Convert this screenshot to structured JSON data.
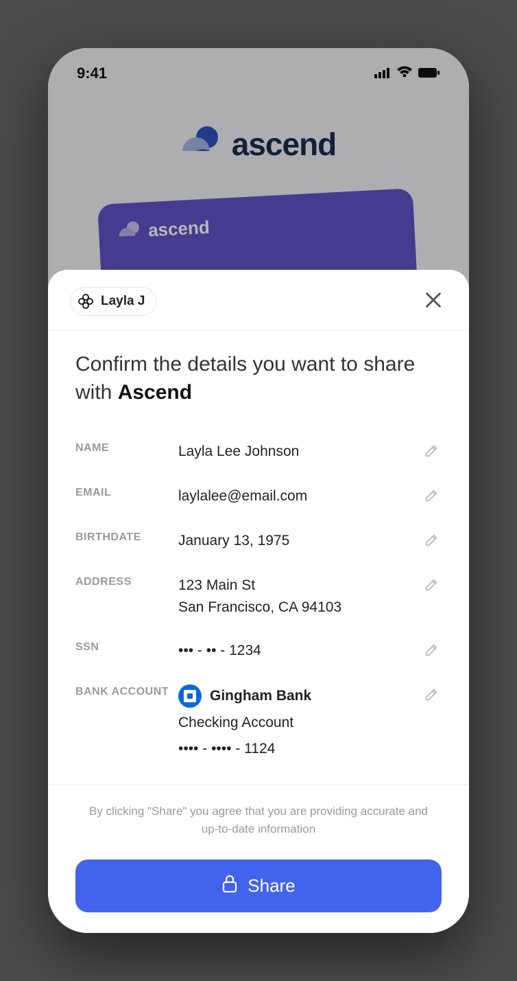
{
  "status": {
    "time": "9:41"
  },
  "brand": {
    "name": "ascend",
    "card_text": "ascend"
  },
  "sheet": {
    "chip_label": "Layla J",
    "heading_prefix": "Confirm the details you want to share with ",
    "heading_company": "Ascend",
    "labels": {
      "name": "NAME",
      "email": "EMAIL",
      "birthdate": "BIRTHDATE",
      "address": "ADDRESS",
      "ssn": "SSN",
      "bank": "BANK ACCOUNT"
    },
    "values": {
      "name": "Layla Lee Johnson",
      "email": "laylalee@email.com",
      "birthdate": "January 13, 1975",
      "address_line1": "123 Main St",
      "address_line2": "San Francisco, CA 94103",
      "ssn": "••• - •• - 1234",
      "bank_name": "Gingham Bank",
      "bank_account_type": "Checking Account",
      "bank_masked": "•••• - •••• - 1124"
    },
    "disclaimer": "By clicking \"Share\" you agree that you are providing accurate and up-to-date information",
    "share_label": "Share"
  }
}
